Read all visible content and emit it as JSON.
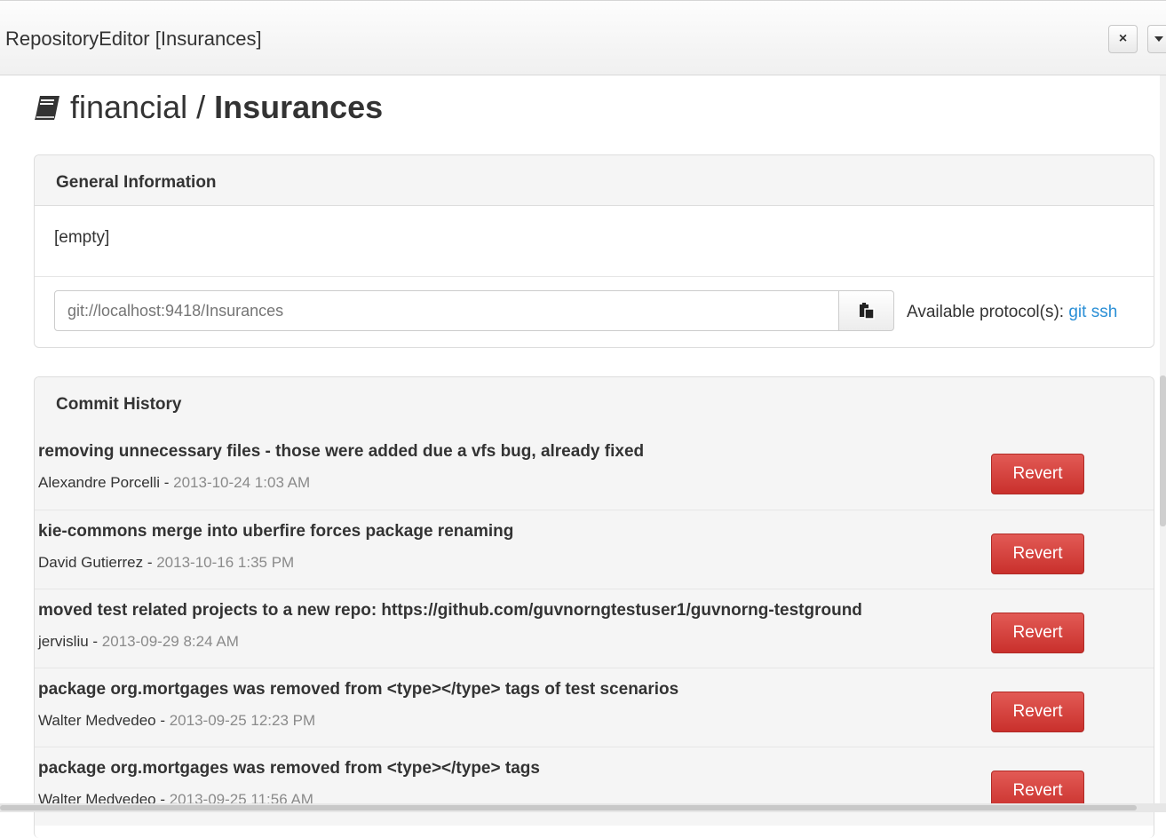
{
  "window": {
    "title": "RepositoryEditor [Insurances]",
    "close_glyph": "×",
    "close_icon": "close-icon",
    "menu_icon": "caret-down-icon"
  },
  "heading": {
    "icon": "book-icon",
    "org": "financial",
    "separator": "/",
    "repo": "Insurances"
  },
  "general": {
    "title": "General Information",
    "description": "[empty]",
    "url_placeholder": "git://localhost:9418/Insurances",
    "copy_icon": "clipboard-icon",
    "protocols_label": "Available protocol(s):",
    "protocols": [
      "git",
      "ssh"
    ]
  },
  "commits": {
    "title": "Commit History",
    "revert_label": "Revert",
    "items": [
      {
        "message": "removing unnecessary files - those were added due a vfs bug, already fixed",
        "author": "Alexandre Porcelli",
        "date": "2013-10-24 1:03 AM"
      },
      {
        "message": "kie-commons merge into uberfire forces package renaming",
        "author": "David Gutierrez",
        "date": "2013-10-16 1:35 PM"
      },
      {
        "message": "moved test related projects to a new repo: https://github.com/guvnorngtestuser1/guvnorng-testground",
        "author": "jervisliu",
        "date": "2013-09-29 8:24 AM"
      },
      {
        "message": "package org.mortgages was removed from <type></type> tags of test scenarios",
        "author": "Walter Medvedeo",
        "date": "2013-09-25 12:23 PM"
      },
      {
        "message": "package org.mortgages was removed from <type></type> tags",
        "author": "Walter Medvedeo",
        "date": "2013-09-25 11:56 AM"
      }
    ]
  },
  "colors": {
    "revert": "#d9534f",
    "link": "#2a8fd6"
  }
}
